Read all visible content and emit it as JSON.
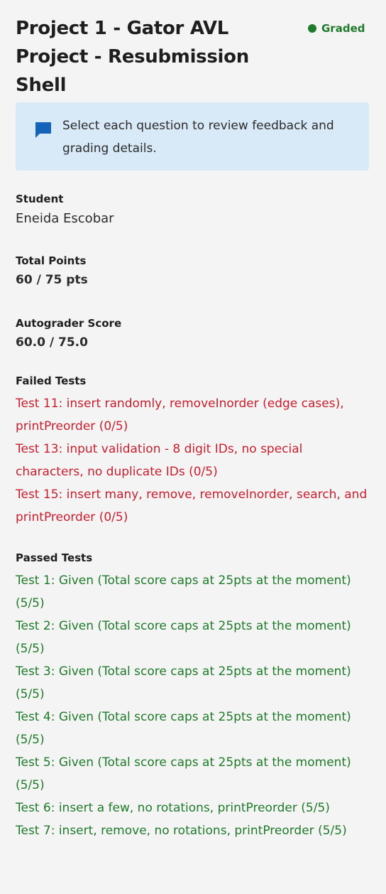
{
  "assignment": {
    "title": "Project 1 - Gator AVL Project - Resubmission Shell",
    "status": "Graded",
    "status_color": "#1f7a2a"
  },
  "notice": {
    "icon": "chat-bubble-icon",
    "text": "Select each question to review feedback and grading details.",
    "background": "#d8e9f8",
    "icon_color": "#1463b8"
  },
  "student": {
    "label": "Student",
    "name": "Eneida Escobar"
  },
  "total_points": {
    "label": "Total Points",
    "value": "60 / 75 pts"
  },
  "autograder": {
    "label": "Autograder Score",
    "value": "60.0 / 75.0"
  },
  "failed_tests": {
    "label": "Failed Tests",
    "color": "#c81e2d",
    "items": [
      "Test 11: insert randomly, removeInorder (edge cases), printPreorder (0/5)",
      "Test 13: input validation - 8 digit IDs, no special characters, no duplicate IDs (0/5)",
      "Test 15: insert many, remove, removeInorder, search, and printPreorder (0/5)"
    ]
  },
  "passed_tests": {
    "label": "Passed Tests",
    "color": "#1f7a2a",
    "items": [
      "Test 1: Given (Total score caps at 25pts at the moment) (5/5)",
      "Test 2: Given (Total score caps at 25pts at the moment) (5/5)",
      "Test 3: Given (Total score caps at 25pts at the moment) (5/5)",
      "Test 4: Given (Total score caps at 25pts at the moment) (5/5)",
      "Test 5: Given (Total score caps at 25pts at the moment) (5/5)",
      "Test 6: insert a few, no rotations, printPreorder (5/5)",
      "Test 7: insert, remove, no rotations, printPreorder (5/5)"
    ]
  }
}
